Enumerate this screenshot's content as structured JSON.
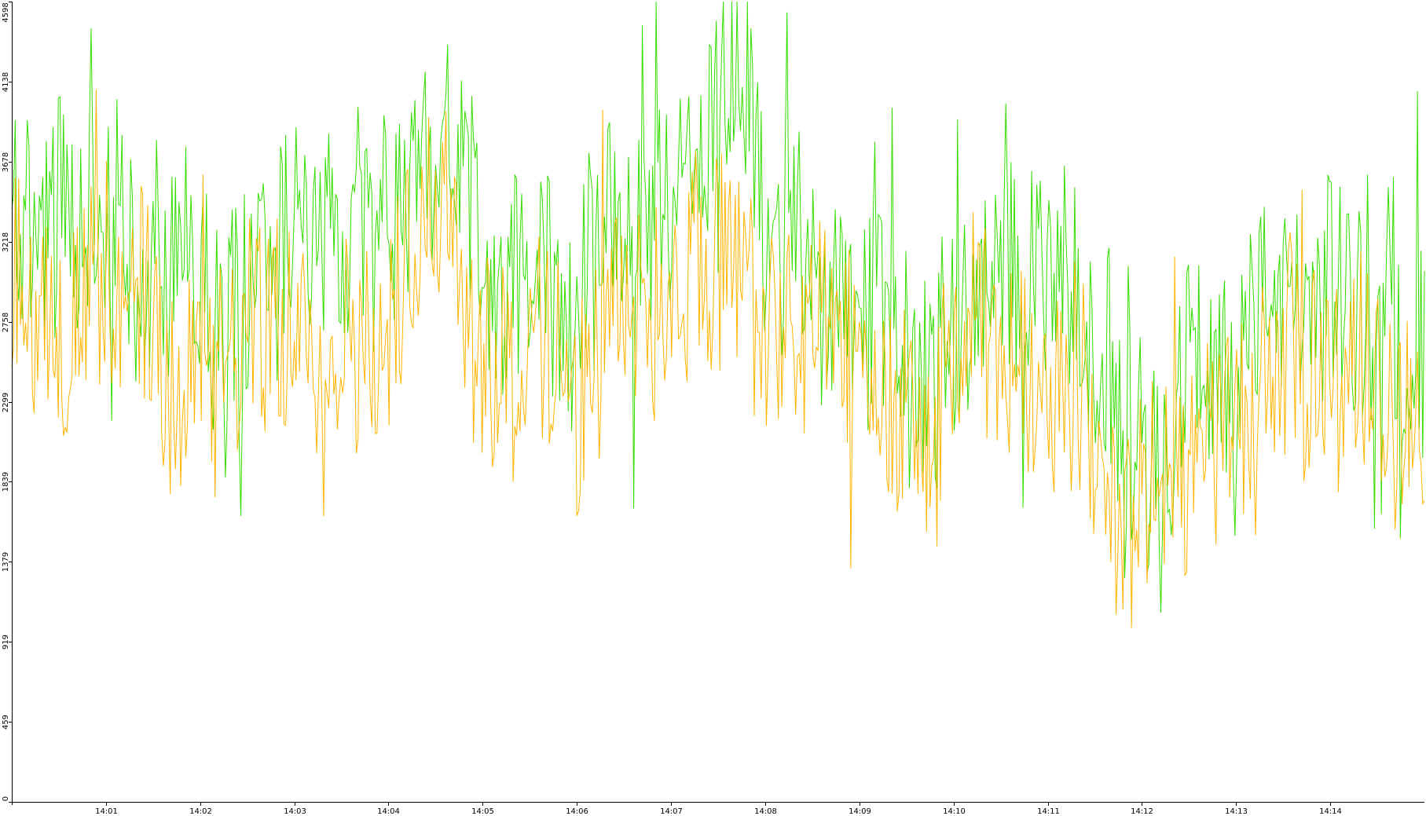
{
  "chart_data": {
    "type": "line",
    "title": "",
    "xlabel": "",
    "ylabel": "",
    "ylim": [
      0,
      4598
    ],
    "grid": false,
    "legend": "none",
    "y_ticks": [
      "0",
      "459",
      "919",
      "1379",
      "1839",
      "2299",
      "2758",
      "3218",
      "3678",
      "4138",
      "4598"
    ],
    "x_ticks": [
      "14:01",
      "14:02",
      "14:03",
      "14:04",
      "14:05",
      "14:06",
      "14:07",
      "14:08",
      "14:09",
      "14:10",
      "14:11",
      "14:12",
      "14:13",
      "14:14"
    ],
    "x_range": [
      "14:00:00",
      "14:15:00"
    ],
    "series": [
      {
        "color": "#33dd00",
        "x": [
          "14:00",
          "14:01",
          "14:02",
          "14:03",
          "14:04",
          "14:04:40",
          "14:05",
          "14:06",
          "14:07",
          "14:07:50",
          "14:08",
          "14:09",
          "14:09:50",
          "14:10",
          "14:11",
          "14:12",
          "14:13",
          "14:14",
          "14:15"
        ],
        "values": [
          3300,
          3250,
          3050,
          3200,
          3200,
          3900,
          3050,
          3050,
          3400,
          4300,
          3100,
          2850,
          2400,
          2900,
          3000,
          2050,
          2700,
          2850,
          2600
        ]
      },
      {
        "color": "#ffb400",
        "x": [
          "14:00",
          "14:01",
          "14:02",
          "14:03",
          "14:04",
          "14:04:40",
          "14:05",
          "14:06",
          "14:07",
          "14:07:50",
          "14:08",
          "14:09",
          "14:09:50",
          "14:10",
          "14:11",
          "14:12",
          "14:13",
          "14:14",
          "14:15"
        ],
        "values": [
          2850,
          2800,
          2400,
          2850,
          2700,
          3600,
          2550,
          2500,
          3000,
          2950,
          2750,
          2450,
          2000,
          2500,
          2600,
          1600,
          2200,
          2500,
          2250
        ]
      }
    ]
  }
}
